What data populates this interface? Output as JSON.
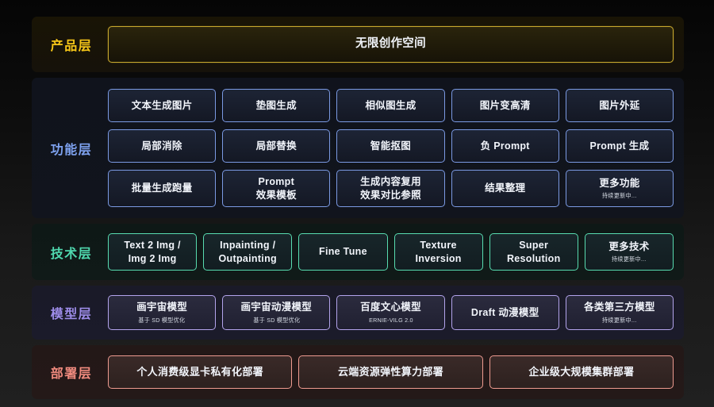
{
  "layers": [
    {
      "key": "product",
      "label": "产品层",
      "accent": "#f5c518",
      "rows": [
        [
          {
            "title": "无限创作空间",
            "subtitle": ""
          }
        ]
      ]
    },
    {
      "key": "function",
      "label": "功能层",
      "accent": "#7ea2ef",
      "rows": [
        [
          {
            "title": "文本生成图片",
            "subtitle": ""
          },
          {
            "title": "垫图生成",
            "subtitle": ""
          },
          {
            "title": "相似图生成",
            "subtitle": ""
          },
          {
            "title": "图片变高清",
            "subtitle": ""
          },
          {
            "title": "图片外延",
            "subtitle": ""
          }
        ],
        [
          {
            "title": "局部消除",
            "subtitle": ""
          },
          {
            "title": "局部替换",
            "subtitle": ""
          },
          {
            "title": "智能抠图",
            "subtitle": ""
          },
          {
            "title": "负 Prompt",
            "subtitle": ""
          },
          {
            "title": "Prompt 生成",
            "subtitle": ""
          }
        ],
        [
          {
            "title": "批量生成跑量",
            "subtitle": ""
          },
          {
            "title": "Prompt\n效果模板",
            "subtitle": ""
          },
          {
            "title": "生成内容复用\n效果对比参照",
            "subtitle": ""
          },
          {
            "title": "结果整理",
            "subtitle": ""
          },
          {
            "title": "更多功能",
            "subtitle": "持续更新中..."
          }
        ]
      ]
    },
    {
      "key": "tech",
      "label": "技术层",
      "accent": "#4fd8ae",
      "rows": [
        [
          {
            "title": "Text 2 Img /\nImg 2 Img",
            "subtitle": ""
          },
          {
            "title": "Inpainting /\nOutpainting",
            "subtitle": ""
          },
          {
            "title": "Fine Tune",
            "subtitle": ""
          },
          {
            "title": "Texture\nInversion",
            "subtitle": ""
          },
          {
            "title": "Super\nResolution",
            "subtitle": ""
          },
          {
            "title": "更多技术",
            "subtitle": "持续更新中..."
          }
        ]
      ]
    },
    {
      "key": "model",
      "label": "模型层",
      "accent": "#9d8ce8",
      "rows": [
        [
          {
            "title": "画宇宙模型",
            "subtitle": "基于 SD 模型优化"
          },
          {
            "title": "画宇宙动漫模型",
            "subtitle": "基于 SD 模型优化"
          },
          {
            "title": "百度文心模型",
            "subtitle": "ERNIE-VILG 2.0"
          },
          {
            "title": "Draft 动漫模型",
            "subtitle": ""
          },
          {
            "title": "各类第三方模型",
            "subtitle": "持续更新中..."
          }
        ]
      ]
    },
    {
      "key": "deploy",
      "label": "部署层",
      "accent": "#ef8a7e",
      "rows": [
        [
          {
            "title": "个人消费级显卡私有化部署",
            "subtitle": ""
          },
          {
            "title": "云端资源弹性算力部署",
            "subtitle": ""
          },
          {
            "title": "企业级大规模集群部署",
            "subtitle": ""
          }
        ]
      ]
    }
  ]
}
